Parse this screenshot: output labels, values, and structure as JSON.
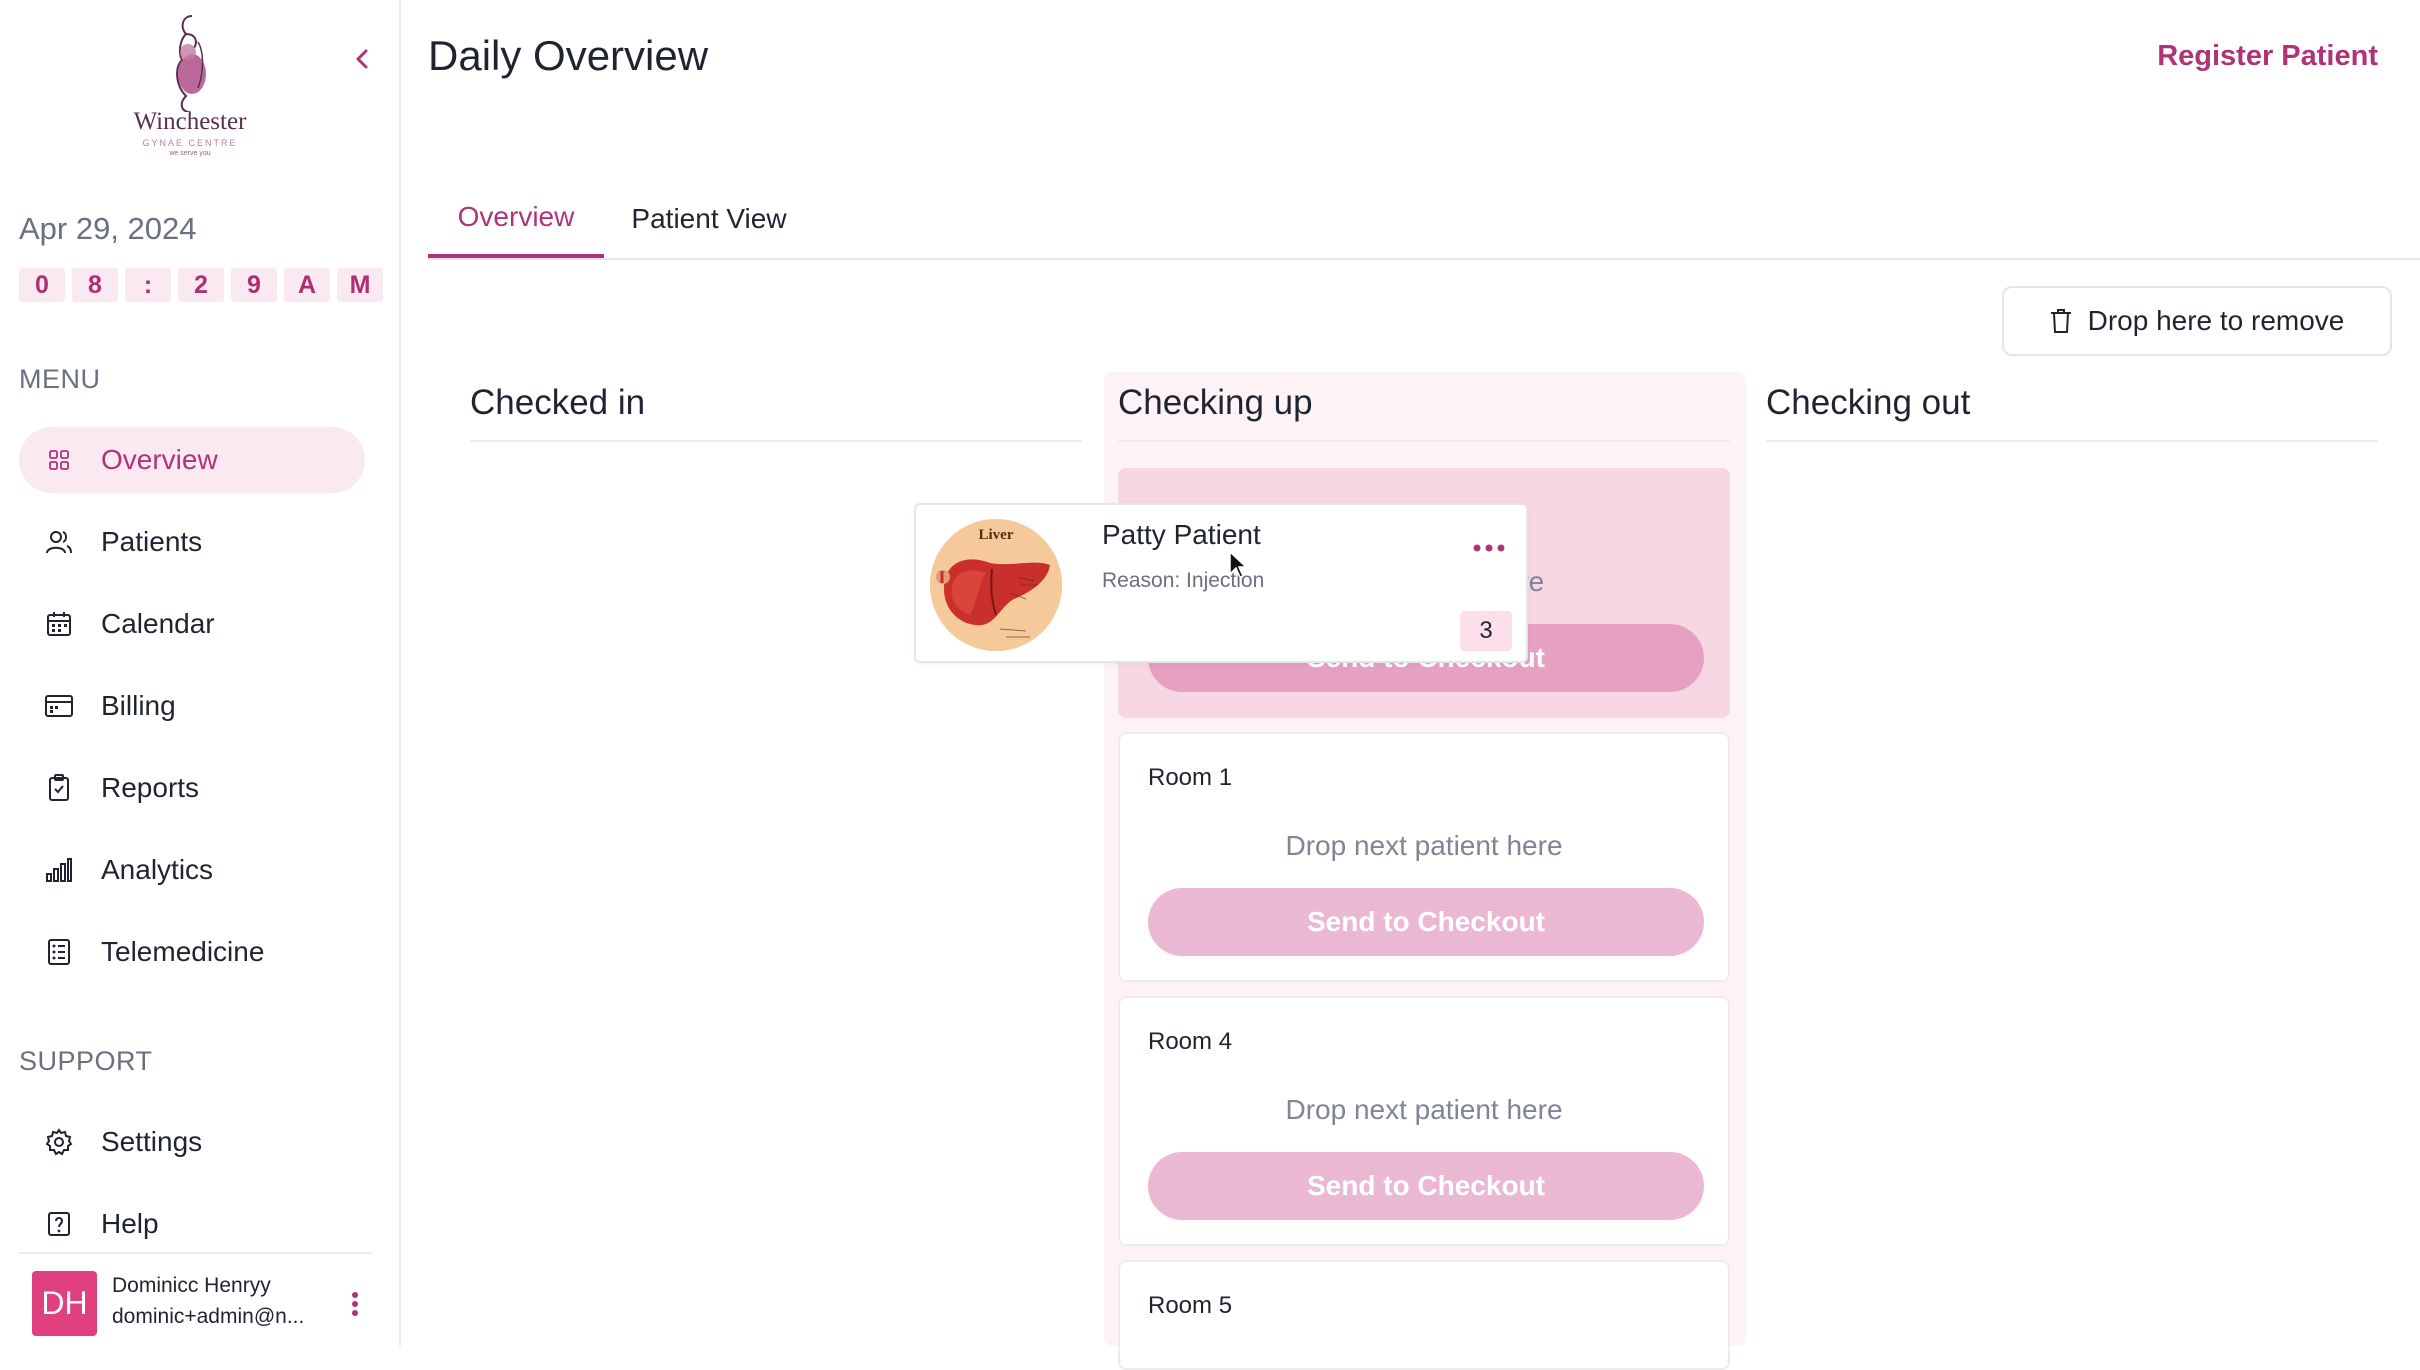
{
  "app": {
    "brand_name": "Winchester",
    "brand_sub": "GYNAE CENTRE",
    "brand_tagline": "we serve you",
    "accent_color": "#b0337a"
  },
  "sidebar": {
    "date": "Apr 29, 2024",
    "time_chars": [
      "0",
      "8",
      ":",
      "2",
      "9",
      "A",
      "M"
    ],
    "menu_label": "MENU",
    "support_label": "SUPPORT",
    "menu_items": [
      {
        "label": "Overview",
        "icon": "grid-icon",
        "active": true
      },
      {
        "label": "Patients",
        "icon": "users-icon",
        "active": false
      },
      {
        "label": "Calendar",
        "icon": "calendar-icon",
        "active": false
      },
      {
        "label": "Billing",
        "icon": "billing-icon",
        "active": false
      },
      {
        "label": "Reports",
        "icon": "clipboard-icon",
        "active": false
      },
      {
        "label": "Analytics",
        "icon": "bar-chart-icon",
        "active": false
      },
      {
        "label": "Telemedicine",
        "icon": "telemedicine-icon",
        "active": false
      }
    ],
    "support_items": [
      {
        "label": "Settings",
        "icon": "gear-icon"
      },
      {
        "label": "Help",
        "icon": "help-icon"
      }
    ],
    "user": {
      "initials": "DH",
      "name": "Dominicc Henryy",
      "email": "dominic+admin@n..."
    }
  },
  "header": {
    "title": "Daily Overview",
    "register_label": "Register Patient"
  },
  "tabs": [
    {
      "label": "Overview",
      "active": true
    },
    {
      "label": "Patient View",
      "active": false
    }
  ],
  "board": {
    "remove_label": "Drop here to remove",
    "columns": [
      {
        "title": "Checked in"
      },
      {
        "title": "Checking up"
      },
      {
        "title": "Checking out"
      }
    ],
    "rooms": [
      {
        "name": "",
        "hint": "ere",
        "button": "Send to Checkout",
        "hover": true
      },
      {
        "name": "Room 1",
        "hint": "Drop next patient here",
        "button": "Send to Checkout"
      },
      {
        "name": "Room 4",
        "hint": "Drop next patient here",
        "button": "Send to Checkout"
      },
      {
        "name": "Room 5"
      }
    ]
  },
  "dragged_patient": {
    "name": "Patty Patient",
    "reason": "Reason: Injection",
    "badge": "3",
    "image_label": "Liver"
  }
}
